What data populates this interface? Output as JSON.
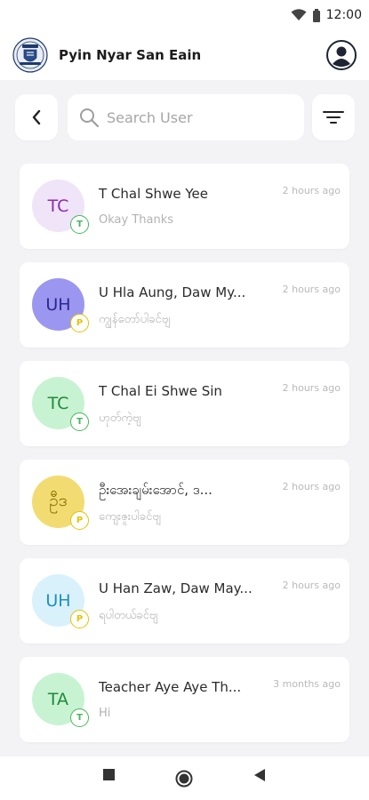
{
  "status": {
    "time": "12:00"
  },
  "header": {
    "title": "Pyin Nyar San Eain"
  },
  "search": {
    "placeholder": "Search User"
  },
  "conversations": [
    {
      "initials": "TC",
      "name": "T Chal Shwe Yee",
      "preview": "Okay Thanks",
      "time": "2 hours ago",
      "role": "T",
      "avatar_bg": "#f0e4f8",
      "avatar_fg": "#8a2db0",
      "badge_color": "#43b85a"
    },
    {
      "initials": "UH",
      "name": "U Hla Aung, Daw My...",
      "preview": "ကျွန်တော်ပါခင်ဗျ",
      "time": "2 hours ago",
      "role": "P",
      "avatar_bg": "#9b97f0",
      "avatar_fg": "#2a2790",
      "badge_color": "#e6c200"
    },
    {
      "initials": "TC",
      "name": "T Chal Ei Shwe Sin",
      "preview": "ဟုတ်ကဲ့ဗျ",
      "time": "2 hours ago",
      "role": "T",
      "avatar_bg": "#c8f3d2",
      "avatar_fg": "#1f8a3a",
      "badge_color": "#43b85a"
    },
    {
      "initials": "ဦဒ",
      "name": "ဦးအေးချမ်းအောင်, ဒ...",
      "preview": "ကျေးဇူးပါခင်ဗျ",
      "time": "2 hours ago",
      "role": "P",
      "avatar_bg": "#f2dc72",
      "avatar_fg": "#8a6d00",
      "badge_color": "#e6c200"
    },
    {
      "initials": "UH",
      "name": "U Han Zaw, Daw May...",
      "preview": "ရပါတယ်ခင်ဗျ",
      "time": "2 hours ago",
      "role": "P",
      "avatar_bg": "#d9f1fb",
      "avatar_fg": "#1d8fc1",
      "badge_color": "#e6c200"
    },
    {
      "initials": "TA",
      "name": "Teacher Aye Aye Th...",
      "preview": "Hi",
      "time": "3 months ago",
      "role": "T",
      "avatar_bg": "#c8f3d2",
      "avatar_fg": "#1f8a3a",
      "badge_color": "#43b85a"
    }
  ]
}
